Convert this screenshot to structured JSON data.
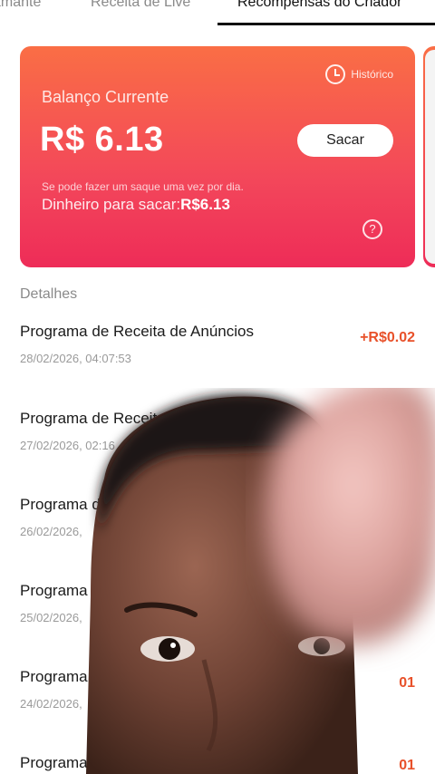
{
  "tabs": [
    {
      "label": "amante"
    },
    {
      "label": "Receita de Live"
    },
    {
      "label": "Recompensas do Criador"
    }
  ],
  "card": {
    "history_label": "Histórico",
    "balance_label": "Balanço Currente",
    "balance_value": "R$ 6.13",
    "withdraw_label": "Sacar",
    "note": "Se pode fazer um saque uma vez por dia.",
    "available_label": "Dinheiro para sacar:",
    "available_value": "R$6.13",
    "help_glyph": "?"
  },
  "details": {
    "label": "Detalhes",
    "items": [
      {
        "title": "Programa de Receita de Anúncios",
        "date": "28/02/2026, 04:07:53",
        "amount": "+R$0.02"
      },
      {
        "title": "Programa de Receita",
        "date": "27/02/2026, 02:16",
        "amount": ""
      },
      {
        "title": "Programa d",
        "date": "26/02/2026,",
        "amount": ""
      },
      {
        "title": "Programa d",
        "date": "25/02/2026,",
        "amount": ""
      },
      {
        "title": "Programa d",
        "date": "24/02/2026,",
        "amount": "01"
      },
      {
        "title": "Programa de",
        "date": "",
        "amount": "01"
      }
    ]
  },
  "icons": {
    "history": "clock-icon",
    "help": "question-circle-icon"
  },
  "colors": {
    "card_top": "#fa6e45",
    "card_bottom": "#ee2c58",
    "amount": "#e8512a"
  }
}
